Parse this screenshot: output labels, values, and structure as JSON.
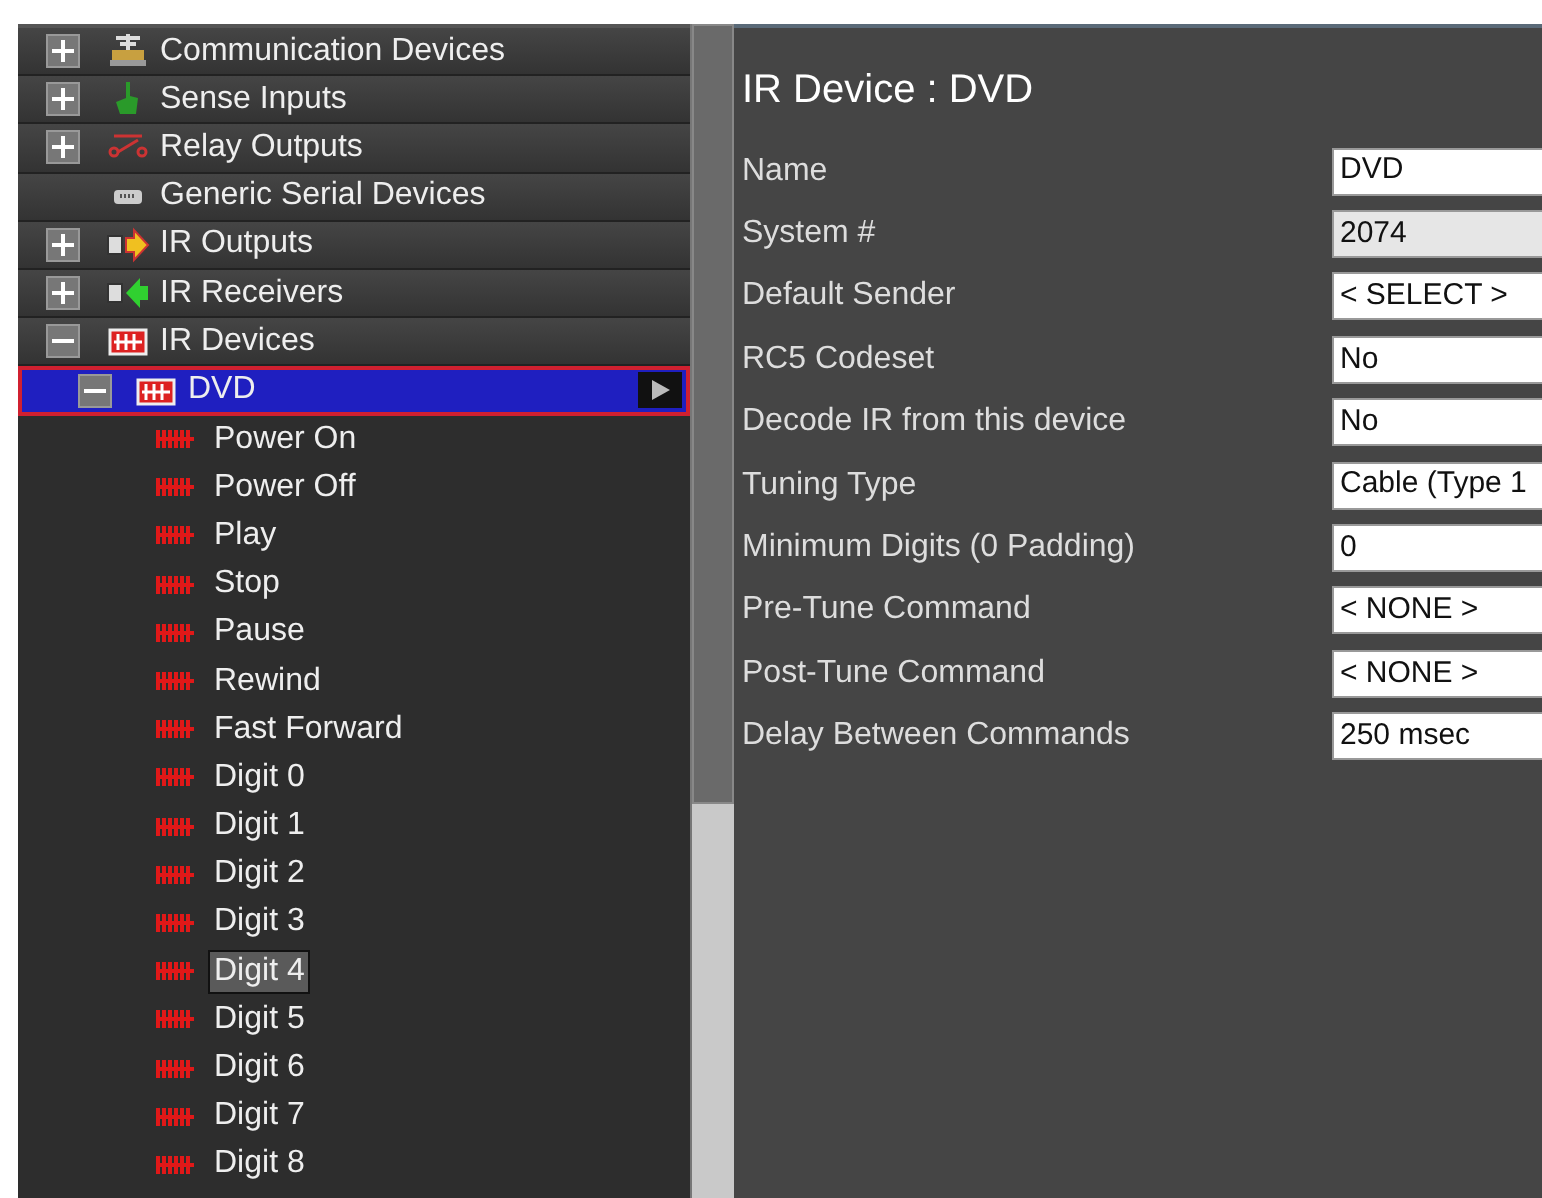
{
  "tree": [
    {
      "label": "Communication Devices",
      "kind": "comm",
      "expanded": false,
      "selected": false
    },
    {
      "label": "Sense Inputs",
      "kind": "sense",
      "expanded": false,
      "selected": false
    },
    {
      "label": "Relay Outputs",
      "kind": "relay",
      "expanded": false,
      "selected": false
    },
    {
      "label": "Generic Serial Devices",
      "kind": "serial",
      "selected": false
    },
    {
      "label": "IR Outputs",
      "kind": "irout",
      "expanded": false,
      "selected": false
    },
    {
      "label": "IR Receivers",
      "kind": "irin",
      "expanded": false,
      "selected": false
    },
    {
      "label": "IR Devices",
      "kind": "irdev",
      "expanded": true,
      "selected": false,
      "children": [
        {
          "label": "DVD",
          "kind": "irdev",
          "expanded": true,
          "selected": true,
          "children": [
            {
              "label": "Power On",
              "selected": false
            },
            {
              "label": "Power Off",
              "selected": false
            },
            {
              "label": "Play",
              "selected": false
            },
            {
              "label": "Stop",
              "selected": false
            },
            {
              "label": "Pause",
              "selected": false
            },
            {
              "label": "Rewind",
              "selected": false
            },
            {
              "label": "Fast Forward",
              "selected": false
            },
            {
              "label": "Digit 0",
              "selected": false
            },
            {
              "label": "Digit 1",
              "selected": false
            },
            {
              "label": "Digit 2",
              "selected": false
            },
            {
              "label": "Digit 3",
              "selected": false
            },
            {
              "label": "Digit 4",
              "selected": true
            },
            {
              "label": "Digit 5",
              "selected": false
            },
            {
              "label": "Digit 6",
              "selected": false
            },
            {
              "label": "Digit 7",
              "selected": false
            },
            {
              "label": "Digit 8",
              "selected": false
            }
          ]
        }
      ]
    }
  ],
  "detail": {
    "title": "IR Device : DVD",
    "fields": [
      {
        "label": "Name",
        "value": "DVD",
        "kind": "text"
      },
      {
        "label": "System #",
        "value": "2074",
        "kind": "readonly"
      },
      {
        "label": "Default Sender",
        "value": "< SELECT >",
        "kind": "select"
      },
      {
        "label": "RC5 Codeset",
        "value": "No",
        "kind": "select"
      },
      {
        "label": "Decode IR from this device",
        "value": "No",
        "kind": "select"
      },
      {
        "label": "Tuning Type",
        "value": "Cable (Type 1",
        "kind": "select"
      },
      {
        "label": "Minimum Digits (0 Padding)",
        "value": "0",
        "kind": "text"
      },
      {
        "label": "Pre-Tune Command",
        "value": "< NONE >",
        "kind": "select"
      },
      {
        "label": "Post-Tune Command",
        "value": "< NONE >",
        "kind": "select"
      },
      {
        "label": "Delay Between Commands",
        "value": "250 msec",
        "kind": "select"
      }
    ]
  }
}
